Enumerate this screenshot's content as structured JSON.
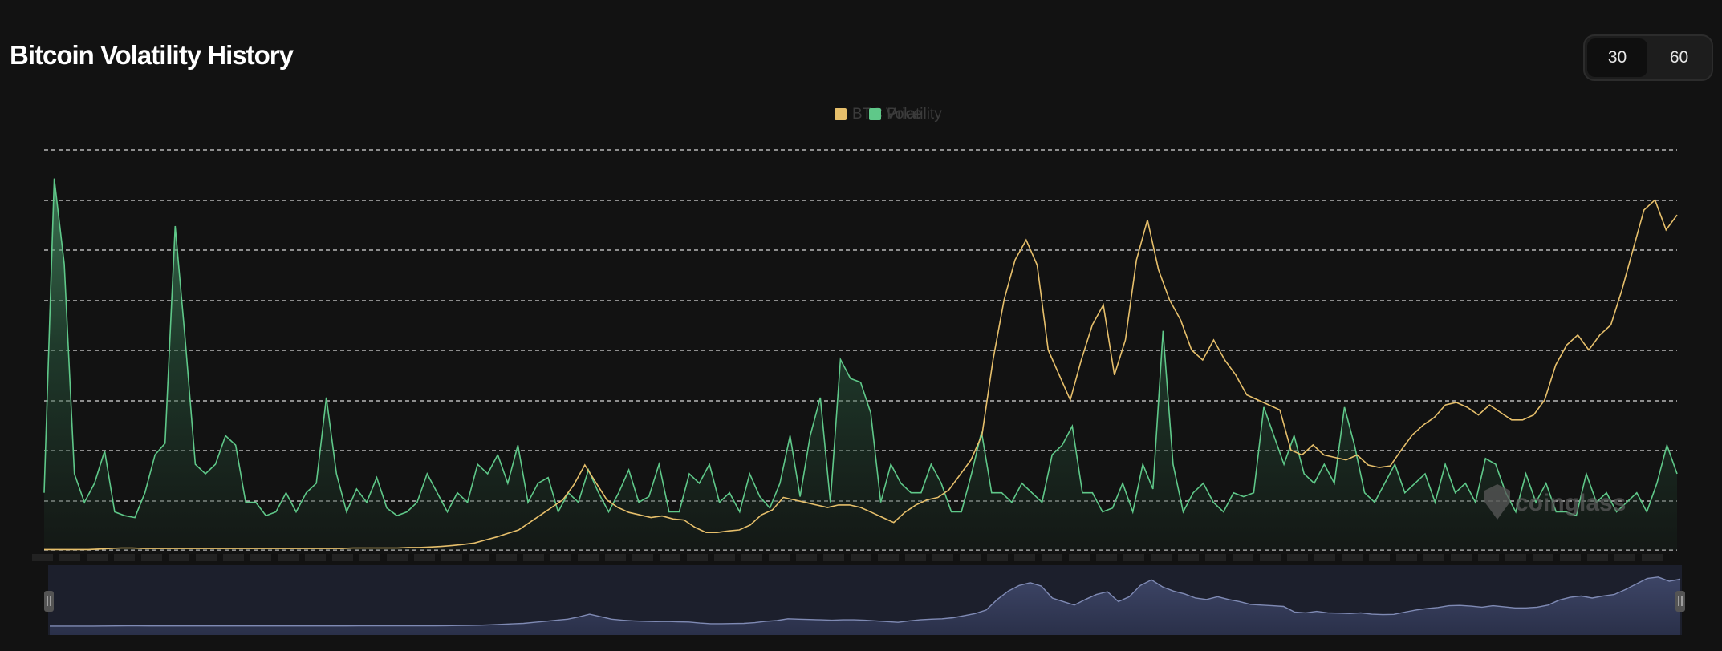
{
  "header": {
    "title": "Bitcoin Volatility History",
    "toggle": {
      "options": [
        "30",
        "60"
      ],
      "selected": "30"
    }
  },
  "watermark": {
    "text": "coinglass"
  },
  "colors": {
    "background": "#121212",
    "price_line": "#e6bf6b",
    "volatility_line": "#5fc889",
    "grid": "#d9d9d9",
    "navigator": "#323a56"
  },
  "chart_data": {
    "type": "line",
    "legend": {
      "position": "top-center",
      "entries": [
        "BTC Price",
        "Volatility"
      ]
    },
    "grid": true,
    "series": [
      {
        "name": "BTC Price",
        "axis": "right",
        "values": [
          0.1,
          0.1,
          0.1,
          0.1,
          0.1,
          0.2,
          0.3,
          0.4,
          0.4,
          0.3,
          0.3,
          0.3,
          0.3,
          0.3,
          0.3,
          0.3,
          0.3,
          0.3,
          0.3,
          0.3,
          0.3,
          0.3,
          0.3,
          0.3,
          0.3,
          0.3,
          0.3,
          0.3,
          0.4,
          0.4,
          0.4,
          0.4,
          0.4,
          0.5,
          0.5,
          0.6,
          0.7,
          0.9,
          1.1,
          1.4,
          2.0,
          2.6,
          3.3,
          4.0,
          5.5,
          7.0,
          8.5,
          10.0,
          13.0,
          17.0,
          13.5,
          10.0,
          8.5,
          7.5,
          7.0,
          6.5,
          6.8,
          6.2,
          6.0,
          4.5,
          3.5,
          3.5,
          3.8,
          4.0,
          5.0,
          7.0,
          8.0,
          10.5,
          10.0,
          9.5,
          9.0,
          8.5,
          9.0,
          9.0,
          8.5,
          7.5,
          6.5,
          5.5,
          7.5,
          9.0,
          10.0,
          10.5,
          12.0,
          15.0,
          18.0,
          23.0,
          38.0,
          50.0,
          58.0,
          62.0,
          57.0,
          40.0,
          35.0,
          30.0,
          38.0,
          45.0,
          49.0,
          35.0,
          42.0,
          58.0,
          66.0,
          56.0,
          50.0,
          46.0,
          40.0,
          38.0,
          42.0,
          38.0,
          35.0,
          31.0,
          30.0,
          29.0,
          28.0,
          20.0,
          19.0,
          21.0,
          19.0,
          18.5,
          18.0,
          19.0,
          17.0,
          16.5,
          16.8,
          20.0,
          23.0,
          25.0,
          26.5,
          29.0,
          29.5,
          28.5,
          27.0,
          29.0,
          27.5,
          26.0,
          26.0,
          27.0,
          30.0,
          37.0,
          41.0,
          43.0,
          40.0,
          43.0,
          45.0,
          52.0,
          60.0,
          68.0,
          70.0,
          64.0,
          67.0
        ]
      },
      {
        "name": "Volatility",
        "axis": "left",
        "values": [
          30,
          195,
          150,
          40,
          25,
          35,
          52,
          20,
          18,
          17,
          30,
          50,
          56,
          170,
          110,
          45,
          40,
          45,
          60,
          55,
          25,
          25,
          18,
          20,
          30,
          20,
          30,
          35,
          80,
          40,
          20,
          32,
          25,
          38,
          22,
          18,
          20,
          25,
          40,
          30,
          20,
          30,
          25,
          45,
          40,
          50,
          35,
          55,
          25,
          35,
          38,
          20,
          30,
          25,
          42,
          30,
          20,
          30,
          42,
          25,
          28,
          45,
          20,
          20,
          40,
          35,
          45,
          25,
          30,
          20,
          40,
          28,
          22,
          35,
          60,
          28,
          60,
          80,
          25,
          100,
          90,
          88,
          72,
          25,
          45,
          35,
          30,
          30,
          45,
          35,
          20,
          20,
          40,
          62,
          30,
          30,
          25,
          35,
          30,
          25,
          50,
          55,
          65,
          30,
          30,
          20,
          22,
          35,
          20,
          45,
          32,
          115,
          45,
          20,
          30,
          35,
          25,
          20,
          30,
          28,
          30,
          75,
          60,
          45,
          60,
          40,
          35,
          45,
          35,
          75,
          55,
          30,
          25,
          35,
          45,
          30,
          35,
          40,
          25,
          45,
          30,
          35,
          25,
          48,
          45,
          30,
          20,
          40,
          25,
          35,
          20,
          20,
          18,
          40,
          25,
          30,
          20,
          25,
          30,
          20,
          35,
          55,
          40
        ]
      }
    ],
    "navigator": true
  }
}
